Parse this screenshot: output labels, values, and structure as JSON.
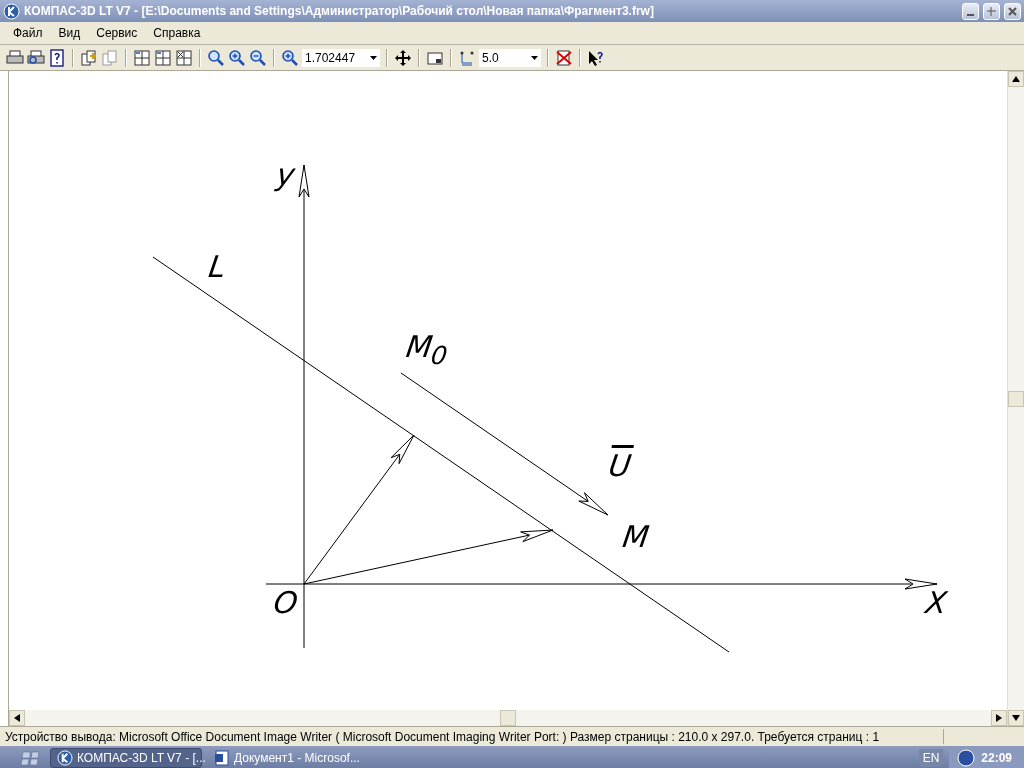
{
  "window": {
    "title": "КОМПАС-3D LT V7 - [E:\\Documents and Settings\\Администратор\\Рабочий стол\\Новая папка\\Фрагмент3.frw]"
  },
  "menu": [
    "Файл",
    "Вид",
    "Сервис",
    "Справка"
  ],
  "toolbar": {
    "zoom_value": "1.702447",
    "step_value": "5.0"
  },
  "drawing": {
    "y_axis_label": "y",
    "line_label": "L",
    "point_m0_label": "M$_{0}$",
    "vector_label": "U",
    "point_m_label": "M",
    "origin_label": "O",
    "x_axis_label": "X"
  },
  "status_bar": {
    "text": "Устройство вывода: Microsoft Office Document Image Writer ( Microsoft Document Imaging Writer Port: )  Размер страницы : 210.0 x 297.0.  Требуется страниц : 1"
  },
  "taskbar": {
    "tasks": [
      {
        "label": "КОМПАС-3D LT V7 - [...",
        "selected": true
      },
      {
        "label": "Документ1 - Microsof...",
        "selected": false
      }
    ],
    "language": "EN",
    "clock": "22:09"
  }
}
